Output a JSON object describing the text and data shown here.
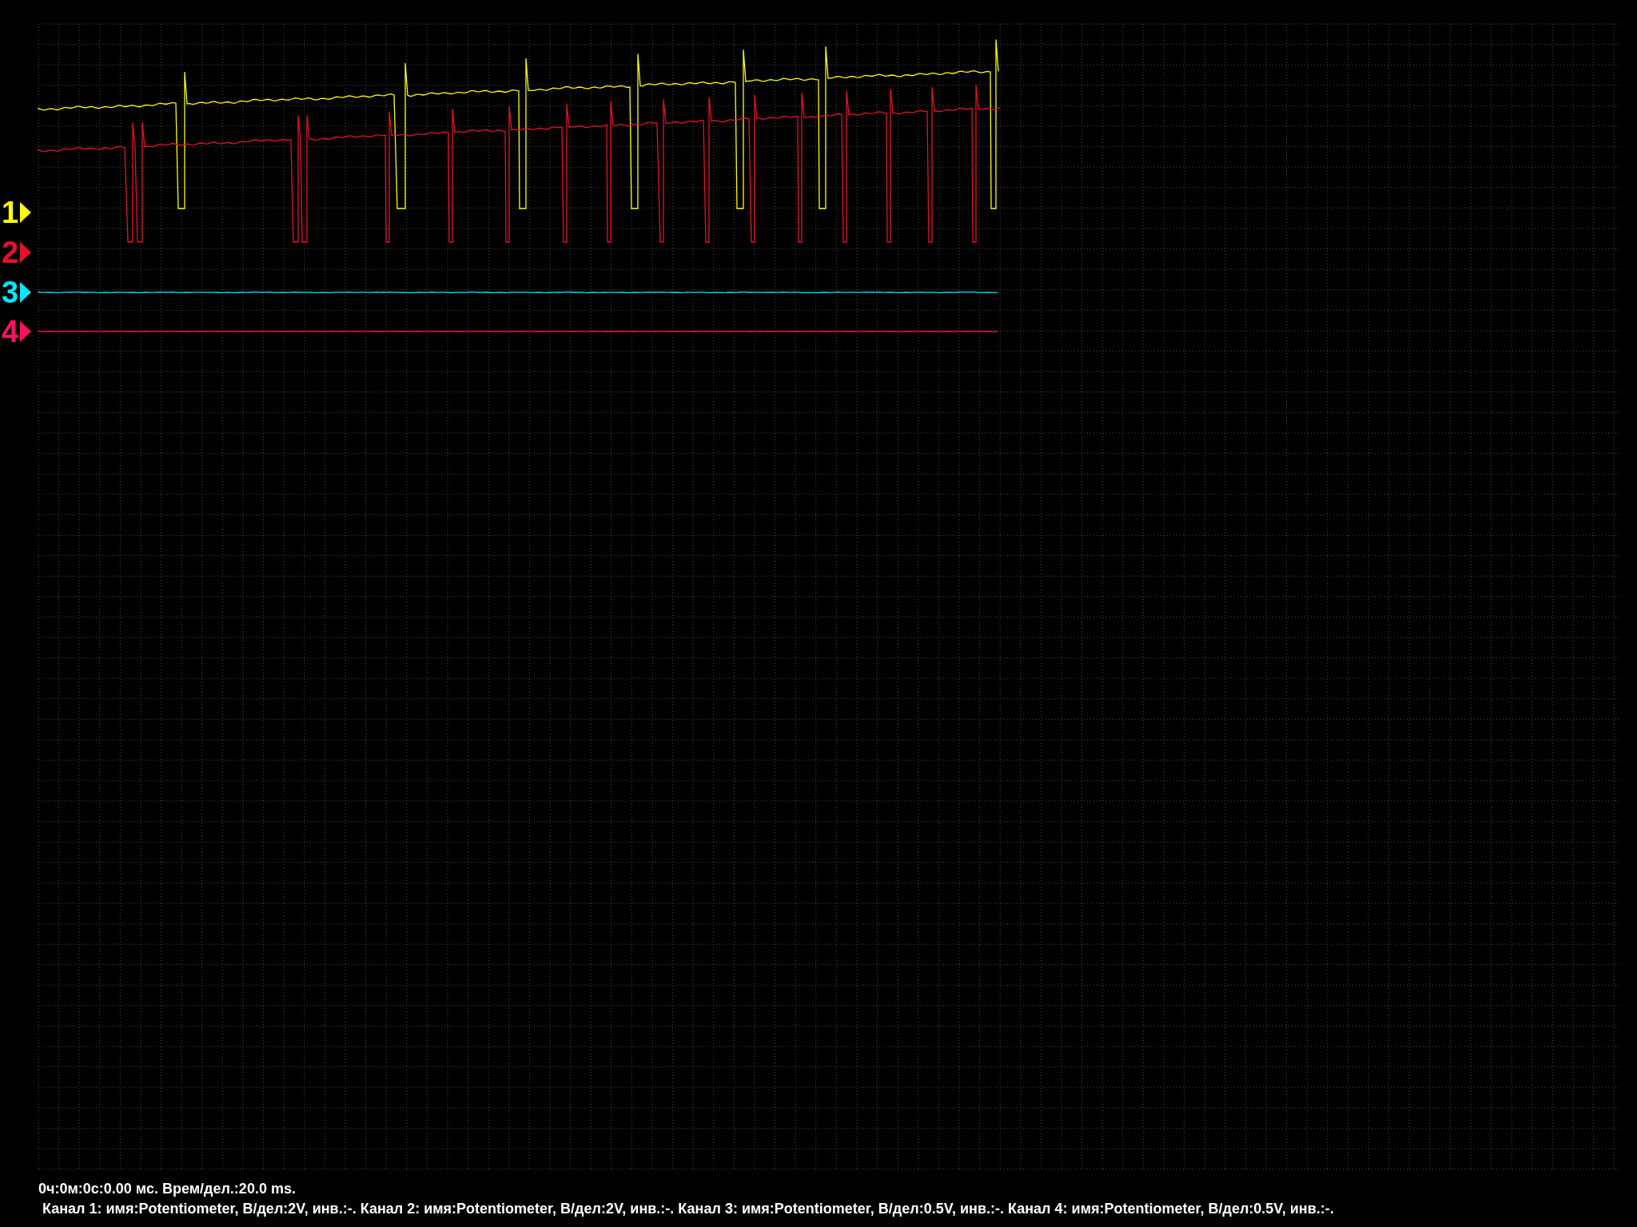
{
  "channels": [
    {
      "number": "1",
      "color": "#ffff00"
    },
    {
      "number": "2",
      "color": "#e8102a"
    },
    {
      "number": "3",
      "color": "#00e8ff"
    },
    {
      "number": "4",
      "color": "#ff1060"
    }
  ],
  "status": {
    "time_line": "0ч:0м:0с:0.00 мс. Врем/дел.:20.0 ms.",
    "channels_line": "Канал 1: имя:Potentiometer, В/дел:2V, инв.:-. Канал 2: имя:Potentiometer, В/дел:2V, инв.:-. Канал 3: имя:Potentiometer, В/дел:0.5V, инв.:-. Канал 4: имя:Potentiometer, В/дел:0.5V, инв.:-."
  }
}
